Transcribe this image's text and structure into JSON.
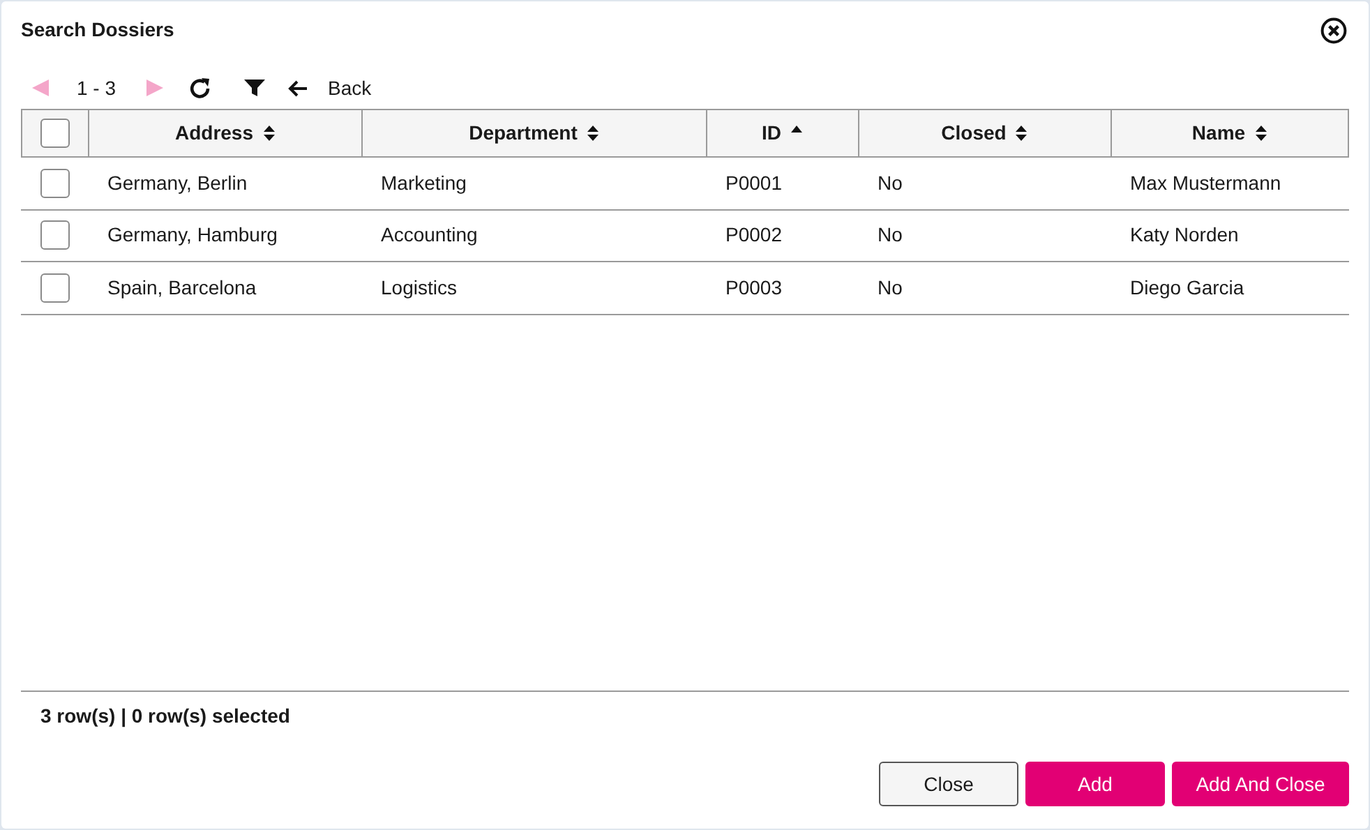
{
  "dialog": {
    "title": "Search Dossiers"
  },
  "toolbar": {
    "prev_disabled": true,
    "range": "1 - 3",
    "next_disabled": true,
    "back_label": "Back"
  },
  "table": {
    "select_all_checked": false,
    "columns": [
      {
        "label": "Address",
        "sorted_ascending": false
      },
      {
        "label": "Department",
        "sorted_ascending": false
      },
      {
        "label": "ID",
        "sorted_ascending": true
      },
      {
        "label": "Closed",
        "sorted_ascending": false
      },
      {
        "label": "Name",
        "sorted_ascending": false
      }
    ],
    "rows": [
      {
        "checked": false,
        "cells": [
          "Germany, Berlin",
          "Marketing",
          "P0001",
          "No",
          "Max Mustermann"
        ]
      },
      {
        "checked": false,
        "cells": [
          "Germany, Hamburg",
          "Accounting",
          "P0002",
          "No",
          "Katy Norden"
        ]
      },
      {
        "checked": false,
        "cells": [
          "Spain, Barcelona",
          "Logistics",
          "P0003",
          "No",
          "Diego Garcia"
        ]
      }
    ]
  },
  "status": "3 row(s) | 0 row(s) selected",
  "buttons": [
    {
      "label": "Close",
      "kind": "secondary"
    },
    {
      "label": "Add",
      "kind": "primary"
    },
    {
      "label": "Add And Close",
      "kind": "primary"
    }
  ]
}
